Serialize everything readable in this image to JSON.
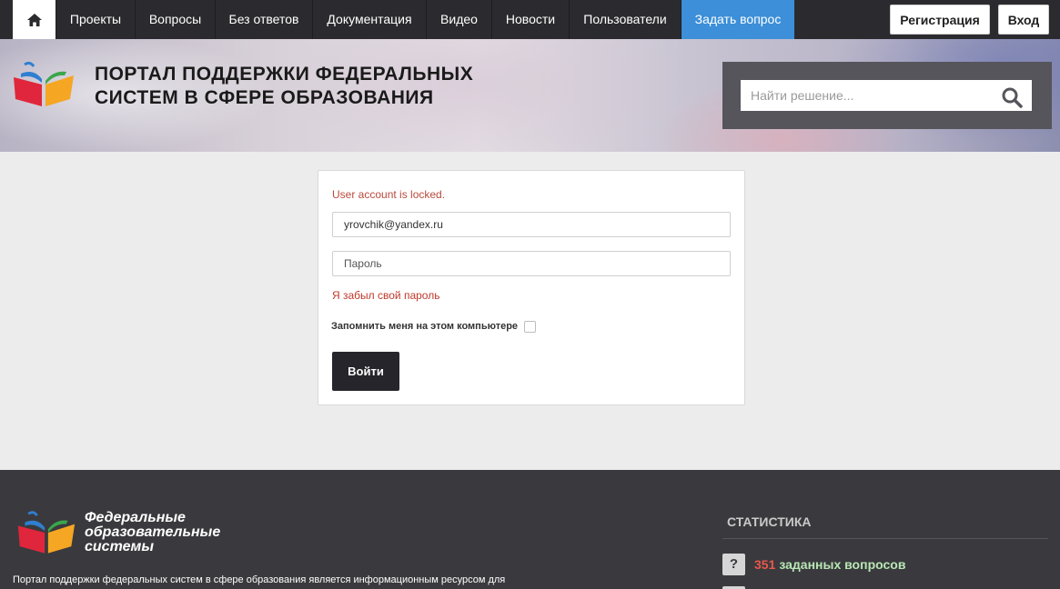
{
  "nav": {
    "items": [
      "Проекты",
      "Вопросы",
      "Без ответов",
      "Документация",
      "Видео",
      "Новости",
      "Пользователи"
    ],
    "ask": "Задать вопрос",
    "register": "Регистрация",
    "login": "Вход"
  },
  "banner": {
    "title_line1": "ПОРТАЛ ПОДДЕРЖКИ ФЕДЕРАЛЬНЫХ",
    "title_line2": "СИСТЕМ В СФЕРЕ ОБРАЗОВАНИЯ",
    "search_placeholder": "Найти решение..."
  },
  "login": {
    "error": "User account is locked.",
    "email_value": "yrovchik@yandex.ru",
    "password_placeholder": "Пароль",
    "forgot": "Я забыл свой пароль",
    "remember": "Запомнить меня на этом компьютере",
    "submit": "Войти"
  },
  "footer": {
    "brand_line1": "Федеральные",
    "brand_line2": "образовательные",
    "brand_line3": "системы",
    "description": "Портал поддержки федеральных систем в сфере образования является информационным ресурсом для",
    "stats_title": "СТАТИСТИКА",
    "stat_count": "351",
    "stat_label": "заданных вопросов"
  },
  "colors": {
    "nav_bg": "#2b2b2f",
    "accent": "#3c8fd8",
    "error": "#b94a3a",
    "footer_bg": "#3a3a3e"
  }
}
